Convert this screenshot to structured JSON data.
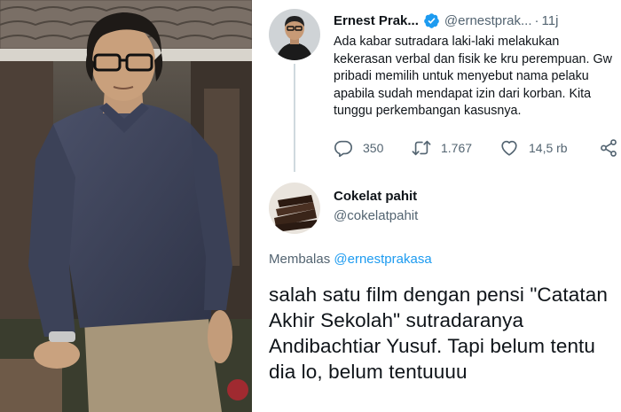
{
  "tweet": {
    "author_name": "Ernest Prak...",
    "author_handle": "@ernestprak...",
    "separator": "·",
    "time": "11j",
    "text": "Ada kabar sutradara laki-laki melakukan kekerasan verbal dan fisik ke kru perempuan. Gw pribadi memilih untuk menyebut nama pelaku apabila sudah mendapat izin dari korban. Kita tunggu perkembangan kasusnya.",
    "reply_count": "350",
    "retweet_count": "1.767",
    "like_count": "14,5 rb",
    "icons": [
      "verified-badge-icon",
      "more-icon",
      "reply-icon",
      "retweet-icon",
      "like-icon",
      "share-icon"
    ]
  },
  "reply": {
    "author_name": "Cokelat pahit",
    "author_handle": "@cokelatpahit",
    "replying_prefix": "Membalas",
    "replying_mention": "@ernestprakasa",
    "text": "salah satu film dengan pensi \"Catatan Akhir Sekolah\" sutradaranya Andibachtiar Yusuf. Tapi belum tentu dia lo, belum tentuuuu"
  },
  "colors": {
    "accent": "#1d9bf0",
    "text": "#0f1419",
    "secondary": "#536471"
  }
}
